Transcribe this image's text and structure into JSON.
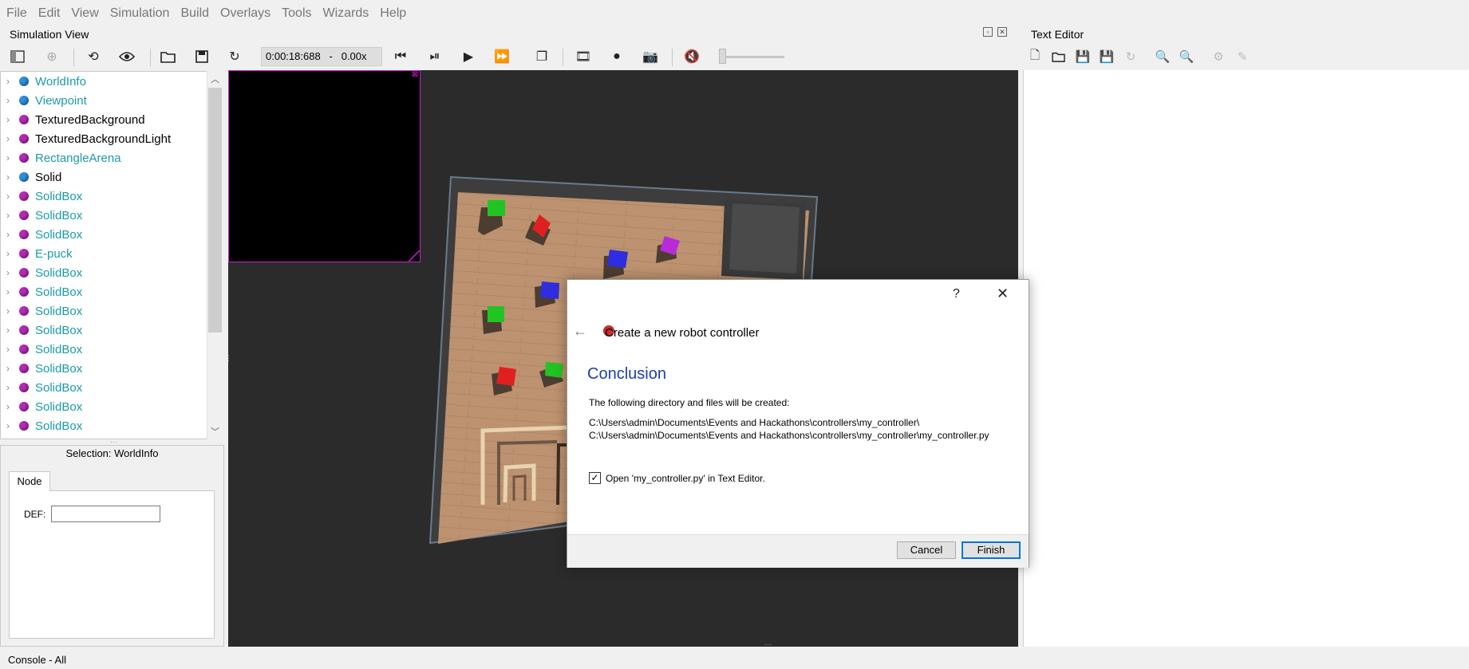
{
  "menu": [
    "File",
    "Edit",
    "View",
    "Simulation",
    "Build",
    "Overlays",
    "Tools",
    "Wizards",
    "Help"
  ],
  "simulation_view": {
    "title": "Simulation View",
    "time": "0:00:18:688",
    "time_sep": "-",
    "speed": "0.00x"
  },
  "text_editor": {
    "title": "Text Editor"
  },
  "scene_tree": {
    "items": [
      {
        "label": "WorldInfo",
        "color": "#2d8fe0",
        "text_color": "#1a9ba8"
      },
      {
        "label": "Viewpoint",
        "color": "#2d8fe0",
        "text_color": "#1a9ba8"
      },
      {
        "label": "TexturedBackground",
        "color": "#b62ab6",
        "text_color": "#000000"
      },
      {
        "label": "TexturedBackgroundLight",
        "color": "#b62ab6",
        "text_color": "#000000"
      },
      {
        "label": "RectangleArena",
        "color": "#b62ab6",
        "text_color": "#1a9ba8"
      },
      {
        "label": "Solid",
        "color": "#2d8fe0",
        "text_color": "#000000"
      },
      {
        "label": "SolidBox",
        "color": "#b62ab6",
        "text_color": "#1a9ba8"
      },
      {
        "label": "SolidBox",
        "color": "#b62ab6",
        "text_color": "#1a9ba8"
      },
      {
        "label": "SolidBox",
        "color": "#b62ab6",
        "text_color": "#1a9ba8"
      },
      {
        "label": "E-puck",
        "color": "#b62ab6",
        "text_color": "#1a9ba8"
      },
      {
        "label": "SolidBox",
        "color": "#b62ab6",
        "text_color": "#1a9ba8"
      },
      {
        "label": "SolidBox",
        "color": "#b62ab6",
        "text_color": "#1a9ba8"
      },
      {
        "label": "SolidBox",
        "color": "#b62ab6",
        "text_color": "#1a9ba8"
      },
      {
        "label": "SolidBox",
        "color": "#b62ab6",
        "text_color": "#1a9ba8"
      },
      {
        "label": "SolidBox",
        "color": "#b62ab6",
        "text_color": "#1a9ba8"
      },
      {
        "label": "SolidBox",
        "color": "#b62ab6",
        "text_color": "#1a9ba8"
      },
      {
        "label": "SolidBox",
        "color": "#b62ab6",
        "text_color": "#1a9ba8"
      },
      {
        "label": "SolidBox",
        "color": "#b62ab6",
        "text_color": "#1a9ba8"
      },
      {
        "label": "SolidBox",
        "color": "#b62ab6",
        "text_color": "#1a9ba8"
      }
    ]
  },
  "node_panel": {
    "selection": "Selection: WorldInfo",
    "tab": "Node",
    "def_label": "DEF:"
  },
  "console": {
    "title": "Console - All"
  },
  "dialog": {
    "help": "?",
    "close": "✕",
    "back": "←",
    "header": "Create a new robot controller",
    "heading": "Conclusion",
    "intro": "The following directory and files will be created:",
    "paths": [
      "C:\\Users\\admin\\Documents\\Events and Hackathons\\controllers\\my_controller\\",
      "C:\\Users\\admin\\Documents\\Events and Hackathons\\controllers\\my_controller\\my_controller.py"
    ],
    "checkbox_label": "Open 'my_controller.py' in Text Editor.",
    "checkbox_checked": true,
    "cancel": "Cancel",
    "finish": "Finish"
  }
}
